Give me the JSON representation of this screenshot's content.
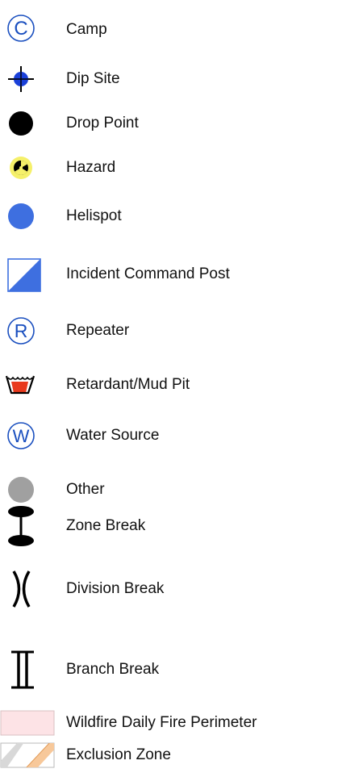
{
  "legend": {
    "items": [
      {
        "label": "Camp",
        "icon": "camp-icon",
        "color": "#1a4fbf"
      },
      {
        "label": "Dip Site",
        "icon": "dip-site-icon",
        "color": "#1a40d9"
      },
      {
        "label": "Drop Point",
        "icon": "drop-point-icon",
        "color": "#000000"
      },
      {
        "label": "Hazard",
        "icon": "hazard-icon",
        "color": "#f5f06a"
      },
      {
        "label": "Helispot",
        "icon": "helispot-icon",
        "color": "#3e6fe0"
      },
      {
        "label": "Incident Command Post",
        "icon": "incident-command-post-icon",
        "color": "#3e6fe0"
      },
      {
        "label": "Repeater",
        "icon": "repeater-icon",
        "color": "#1a4fbf"
      },
      {
        "label": "Retardant/Mud Pit",
        "icon": "retardant-mud-pit-icon",
        "color": "#e8391d"
      },
      {
        "label": "Water Source",
        "icon": "water-source-icon",
        "color": "#1a4fbf"
      },
      {
        "label": "Other",
        "icon": "other-icon",
        "color": "#a0a0a0"
      },
      {
        "label": "Zone Break",
        "icon": "zone-break-icon",
        "color": "#000000"
      },
      {
        "label": "Division Break",
        "icon": "division-break-icon",
        "color": "#000000"
      },
      {
        "label": "Branch Break",
        "icon": "branch-break-icon",
        "color": "#000000"
      },
      {
        "label": "Wildfire Daily Fire Perimeter",
        "icon": "fire-perimeter-swatch",
        "color": "#fde3e6"
      },
      {
        "label": "Exclusion Zone",
        "icon": "exclusion-zone-swatch",
        "color": "#f7c89a"
      }
    ]
  }
}
